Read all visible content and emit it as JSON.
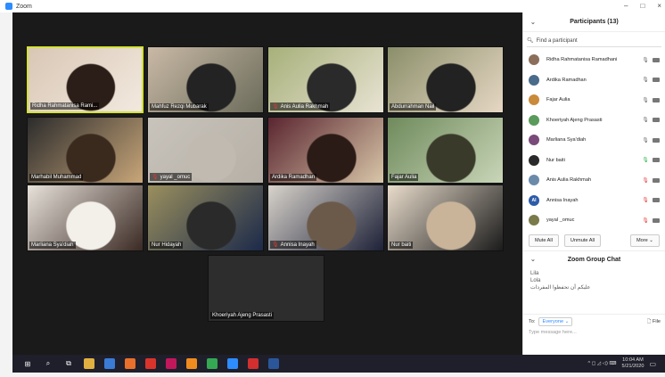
{
  "window": {
    "title": "Zoom",
    "controls": [
      "–",
      "□",
      "×"
    ]
  },
  "tiles": [
    {
      "name": "Ridha Rahmatanisa Rami...",
      "muted": false,
      "active": true,
      "colors": [
        "#d9c7b5",
        "#f2e9df",
        "#2b1e18"
      ]
    },
    {
      "name": "Mahfuz Rezqi Mubarak",
      "muted": false,
      "active": false,
      "colors": [
        "#c9b9a6",
        "#6b6b5a",
        "#232323"
      ]
    },
    {
      "name": "Anis Aulia Rakhmah",
      "muted": true,
      "active": false,
      "colors": [
        "#a7b07a",
        "#e8e3d3",
        "#2a2a2a"
      ]
    },
    {
      "name": "Abdurrahman Nail",
      "muted": false,
      "active": false,
      "colors": [
        "#8b8f6a",
        "#e6d7c4",
        "#222"
      ]
    },
    {
      "name": "Marhabil Muhammad",
      "muted": false,
      "active": false,
      "colors": [
        "#2c2c2c",
        "#c8a679",
        "#3a2a1e"
      ]
    },
    {
      "name": "yayal _omuc",
      "muted": true,
      "active": false,
      "colors": [
        "#c8c3bb",
        "#b6b0a6",
        "#c0bab1"
      ]
    },
    {
      "name": "Ardika Ramadhan",
      "muted": false,
      "active": false,
      "colors": [
        "#5a2530",
        "#d8c6a8",
        "#2b1b16"
      ]
    },
    {
      "name": "Fajar Aulia",
      "muted": false,
      "active": false,
      "colors": [
        "#6f8a5c",
        "#c9d6b8",
        "#3a3a2a"
      ]
    },
    {
      "name": "Marliana Sya'diah",
      "muted": false,
      "active": false,
      "colors": [
        "#e7e2da",
        "#3b2a24",
        "#f3efe9"
      ]
    },
    {
      "name": "Nur Hidayah",
      "muted": false,
      "active": false,
      "colors": [
        "#9a8f5e",
        "#1c2a4a",
        "#2a2a2a"
      ]
    },
    {
      "name": "Annisa Inayah",
      "muted": true,
      "active": false,
      "colors": [
        "#d8d3cb",
        "#1e2238",
        "#6b5a4a"
      ]
    },
    {
      "name": "Nur baiti",
      "muted": false,
      "active": false,
      "colors": [
        "#e8dccb",
        "#1b1b1b",
        "#c9b49a"
      ]
    },
    {
      "name": "Khoeriyah Ajeng Prasasti",
      "muted": false,
      "active": false,
      "colors": [
        "#2d2d2d",
        "#2d2d2d",
        "#2d2d2d"
      ]
    }
  ],
  "panel": {
    "participants_title": "Participants (13)",
    "find_placeholder": "Find a participant",
    "participants": [
      {
        "name": "Ridha Rahmatanisa Ramadhani",
        "mic": "on",
        "avatar_color": "#8b6f5a",
        "initials": ""
      },
      {
        "name": "Ardika Ramadhan",
        "mic": "on",
        "avatar_color": "#4a6b8a",
        "initials": ""
      },
      {
        "name": "Fajar Aulia",
        "mic": "on",
        "avatar_color": "#c98a3a",
        "initials": ""
      },
      {
        "name": "Khoeriyah Ajeng Prasasti",
        "mic": "on",
        "avatar_color": "#5a9a5a",
        "initials": ""
      },
      {
        "name": "Marliana Sya'diah",
        "mic": "on",
        "avatar_color": "#7a4a7a",
        "initials": ""
      },
      {
        "name": "Nur baiti",
        "mic": "live",
        "avatar_color": "#2a2a2a",
        "initials": ""
      },
      {
        "name": "Anis Aulia Rakhmah",
        "mic": "muted",
        "avatar_color": "#6a8aaa",
        "initials": ""
      },
      {
        "name": "Annisa Inayah",
        "mic": "muted",
        "avatar_color": "#2d5ba8",
        "initials": "AI"
      },
      {
        "name": "yayal _omuc",
        "mic": "muted",
        "avatar_color": "#7a7a4a",
        "initials": ""
      }
    ],
    "buttons": {
      "mute_all": "Mute All",
      "unmute_all": "Unmute All",
      "more": "More ⌄"
    },
    "chat_title": "Zoom Group Chat",
    "chat_messages": [
      "Lila",
      "Lola",
      "عليكم أن تحفظوا المفردات"
    ],
    "to_label": "To:",
    "to_value": "Everyone ⌄",
    "file_label": "File",
    "input_placeholder": "Type message here..."
  },
  "taskbar": {
    "icons": [
      {
        "name": "windows-start-icon",
        "color": "#1f1f2b",
        "glyph": "⊞"
      },
      {
        "name": "search-icon",
        "color": "#1f1f2b",
        "glyph": "⌕"
      },
      {
        "name": "task-view-icon",
        "color": "#1f1f2b",
        "glyph": "⧉"
      },
      {
        "name": "file-explorer-icon",
        "color": "#e0b040",
        "glyph": ""
      },
      {
        "name": "store-icon",
        "color": "#3a7bd5",
        "glyph": ""
      },
      {
        "name": "firefox-icon",
        "color": "#e8702a",
        "glyph": ""
      },
      {
        "name": "app-red-icon",
        "color": "#d9342b",
        "glyph": ""
      },
      {
        "name": "app-pink-icon",
        "color": "#c2185b",
        "glyph": ""
      },
      {
        "name": "app-orange-icon",
        "color": "#f08c1e",
        "glyph": ""
      },
      {
        "name": "chrome-icon",
        "color": "#34a853",
        "glyph": ""
      },
      {
        "name": "zoom-taskbar-icon",
        "color": "#2d8cff",
        "glyph": ""
      },
      {
        "name": "pdf-icon",
        "color": "#d32f2f",
        "glyph": ""
      },
      {
        "name": "word-icon",
        "color": "#2b579a",
        "glyph": ""
      }
    ],
    "tray": "^ ◻ ◿ ◁) ⌨",
    "time": "10:04 AM",
    "date": "5/21/2020"
  }
}
